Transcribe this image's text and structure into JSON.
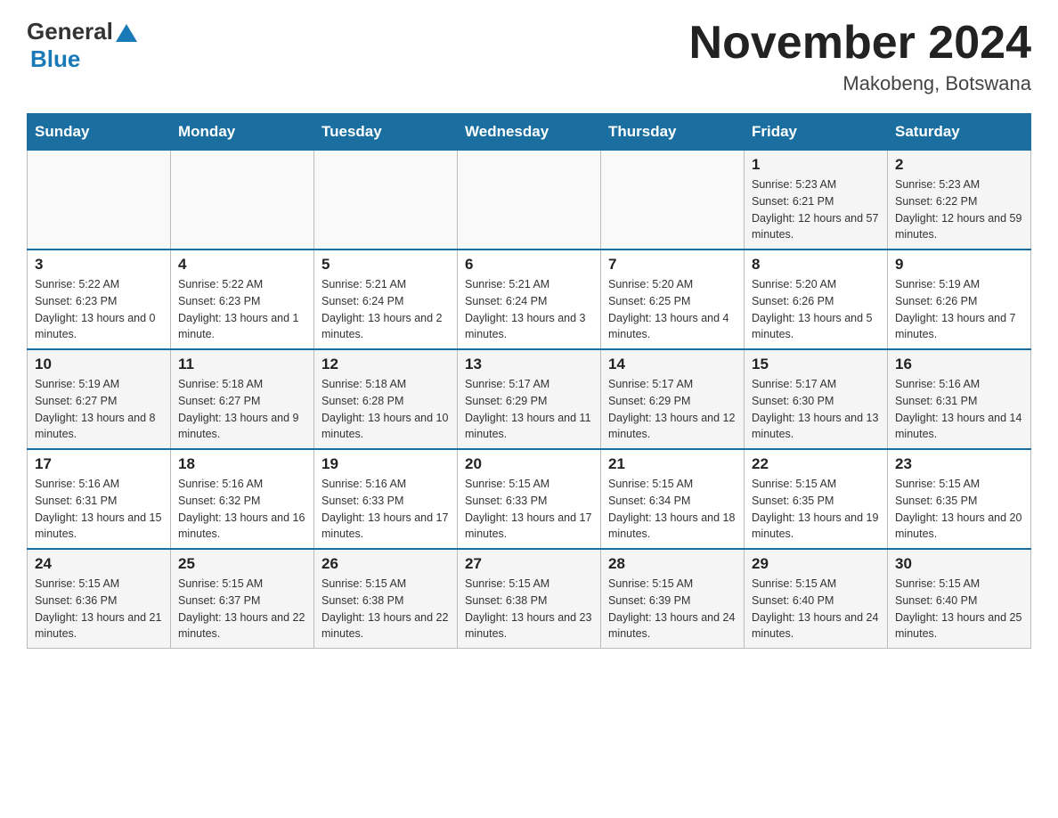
{
  "header": {
    "title": "November 2024",
    "location": "Makobeng, Botswana",
    "logo_general": "General",
    "logo_blue": "Blue"
  },
  "weekdays": [
    "Sunday",
    "Monday",
    "Tuesday",
    "Wednesday",
    "Thursday",
    "Friday",
    "Saturday"
  ],
  "weeks": [
    [
      {
        "day": "",
        "sunrise": "",
        "sunset": "",
        "daylight": ""
      },
      {
        "day": "",
        "sunrise": "",
        "sunset": "",
        "daylight": ""
      },
      {
        "day": "",
        "sunrise": "",
        "sunset": "",
        "daylight": ""
      },
      {
        "day": "",
        "sunrise": "",
        "sunset": "",
        "daylight": ""
      },
      {
        "day": "",
        "sunrise": "",
        "sunset": "",
        "daylight": ""
      },
      {
        "day": "1",
        "sunrise": "Sunrise: 5:23 AM",
        "sunset": "Sunset: 6:21 PM",
        "daylight": "Daylight: 12 hours and 57 minutes."
      },
      {
        "day": "2",
        "sunrise": "Sunrise: 5:23 AM",
        "sunset": "Sunset: 6:22 PM",
        "daylight": "Daylight: 12 hours and 59 minutes."
      }
    ],
    [
      {
        "day": "3",
        "sunrise": "Sunrise: 5:22 AM",
        "sunset": "Sunset: 6:23 PM",
        "daylight": "Daylight: 13 hours and 0 minutes."
      },
      {
        "day": "4",
        "sunrise": "Sunrise: 5:22 AM",
        "sunset": "Sunset: 6:23 PM",
        "daylight": "Daylight: 13 hours and 1 minute."
      },
      {
        "day": "5",
        "sunrise": "Sunrise: 5:21 AM",
        "sunset": "Sunset: 6:24 PM",
        "daylight": "Daylight: 13 hours and 2 minutes."
      },
      {
        "day": "6",
        "sunrise": "Sunrise: 5:21 AM",
        "sunset": "Sunset: 6:24 PM",
        "daylight": "Daylight: 13 hours and 3 minutes."
      },
      {
        "day": "7",
        "sunrise": "Sunrise: 5:20 AM",
        "sunset": "Sunset: 6:25 PM",
        "daylight": "Daylight: 13 hours and 4 minutes."
      },
      {
        "day": "8",
        "sunrise": "Sunrise: 5:20 AM",
        "sunset": "Sunset: 6:26 PM",
        "daylight": "Daylight: 13 hours and 5 minutes."
      },
      {
        "day": "9",
        "sunrise": "Sunrise: 5:19 AM",
        "sunset": "Sunset: 6:26 PM",
        "daylight": "Daylight: 13 hours and 7 minutes."
      }
    ],
    [
      {
        "day": "10",
        "sunrise": "Sunrise: 5:19 AM",
        "sunset": "Sunset: 6:27 PM",
        "daylight": "Daylight: 13 hours and 8 minutes."
      },
      {
        "day": "11",
        "sunrise": "Sunrise: 5:18 AM",
        "sunset": "Sunset: 6:27 PM",
        "daylight": "Daylight: 13 hours and 9 minutes."
      },
      {
        "day": "12",
        "sunrise": "Sunrise: 5:18 AM",
        "sunset": "Sunset: 6:28 PM",
        "daylight": "Daylight: 13 hours and 10 minutes."
      },
      {
        "day": "13",
        "sunrise": "Sunrise: 5:17 AM",
        "sunset": "Sunset: 6:29 PM",
        "daylight": "Daylight: 13 hours and 11 minutes."
      },
      {
        "day": "14",
        "sunrise": "Sunrise: 5:17 AM",
        "sunset": "Sunset: 6:29 PM",
        "daylight": "Daylight: 13 hours and 12 minutes."
      },
      {
        "day": "15",
        "sunrise": "Sunrise: 5:17 AM",
        "sunset": "Sunset: 6:30 PM",
        "daylight": "Daylight: 13 hours and 13 minutes."
      },
      {
        "day": "16",
        "sunrise": "Sunrise: 5:16 AM",
        "sunset": "Sunset: 6:31 PM",
        "daylight": "Daylight: 13 hours and 14 minutes."
      }
    ],
    [
      {
        "day": "17",
        "sunrise": "Sunrise: 5:16 AM",
        "sunset": "Sunset: 6:31 PM",
        "daylight": "Daylight: 13 hours and 15 minutes."
      },
      {
        "day": "18",
        "sunrise": "Sunrise: 5:16 AM",
        "sunset": "Sunset: 6:32 PM",
        "daylight": "Daylight: 13 hours and 16 minutes."
      },
      {
        "day": "19",
        "sunrise": "Sunrise: 5:16 AM",
        "sunset": "Sunset: 6:33 PM",
        "daylight": "Daylight: 13 hours and 17 minutes."
      },
      {
        "day": "20",
        "sunrise": "Sunrise: 5:15 AM",
        "sunset": "Sunset: 6:33 PM",
        "daylight": "Daylight: 13 hours and 17 minutes."
      },
      {
        "day": "21",
        "sunrise": "Sunrise: 5:15 AM",
        "sunset": "Sunset: 6:34 PM",
        "daylight": "Daylight: 13 hours and 18 minutes."
      },
      {
        "day": "22",
        "sunrise": "Sunrise: 5:15 AM",
        "sunset": "Sunset: 6:35 PM",
        "daylight": "Daylight: 13 hours and 19 minutes."
      },
      {
        "day": "23",
        "sunrise": "Sunrise: 5:15 AM",
        "sunset": "Sunset: 6:35 PM",
        "daylight": "Daylight: 13 hours and 20 minutes."
      }
    ],
    [
      {
        "day": "24",
        "sunrise": "Sunrise: 5:15 AM",
        "sunset": "Sunset: 6:36 PM",
        "daylight": "Daylight: 13 hours and 21 minutes."
      },
      {
        "day": "25",
        "sunrise": "Sunrise: 5:15 AM",
        "sunset": "Sunset: 6:37 PM",
        "daylight": "Daylight: 13 hours and 22 minutes."
      },
      {
        "day": "26",
        "sunrise": "Sunrise: 5:15 AM",
        "sunset": "Sunset: 6:38 PM",
        "daylight": "Daylight: 13 hours and 22 minutes."
      },
      {
        "day": "27",
        "sunrise": "Sunrise: 5:15 AM",
        "sunset": "Sunset: 6:38 PM",
        "daylight": "Daylight: 13 hours and 23 minutes."
      },
      {
        "day": "28",
        "sunrise": "Sunrise: 5:15 AM",
        "sunset": "Sunset: 6:39 PM",
        "daylight": "Daylight: 13 hours and 24 minutes."
      },
      {
        "day": "29",
        "sunrise": "Sunrise: 5:15 AM",
        "sunset": "Sunset: 6:40 PM",
        "daylight": "Daylight: 13 hours and 24 minutes."
      },
      {
        "day": "30",
        "sunrise": "Sunrise: 5:15 AM",
        "sunset": "Sunset: 6:40 PM",
        "daylight": "Daylight: 13 hours and 25 minutes."
      }
    ]
  ]
}
